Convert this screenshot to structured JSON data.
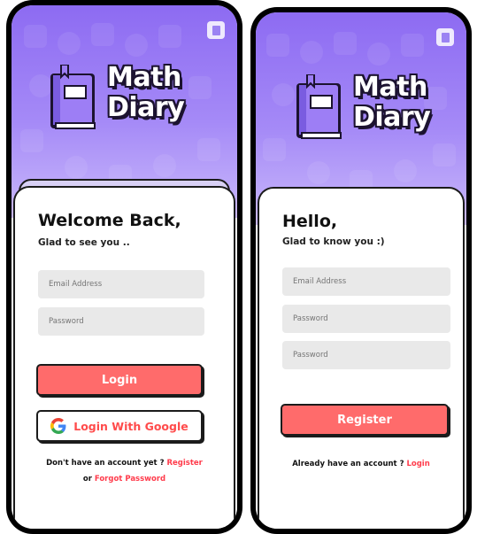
{
  "brand": {
    "logo_line1": "Math",
    "logo_line2": "Diary",
    "colors": {
      "purple": "#8d6bf2",
      "accent": "#ff6b6b",
      "link": "#ff3b4b"
    }
  },
  "login": {
    "title": "Welcome Back,",
    "subtitle": "Glad to see you ..",
    "email_placeholder": "Email Address",
    "password_placeholder": "Password",
    "login_button": "Login",
    "google_button": "Login With Google",
    "no_account_text": "Don't have an account yet ?",
    "register_link": "Register",
    "or_text": "or",
    "forgot_link": "Forgot Password"
  },
  "register": {
    "title": "Hello,",
    "subtitle": "Glad to know you :)",
    "email_placeholder": "Email Address",
    "password_placeholder": "Password",
    "confirm_placeholder": "Password",
    "register_button": "Register",
    "have_account_text": "Already have an account ?",
    "login_link": "Login"
  }
}
